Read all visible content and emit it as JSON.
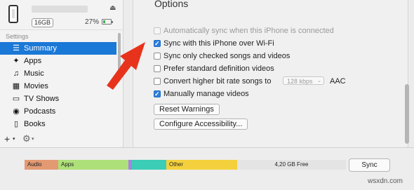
{
  "device": {
    "capacity": "16GB",
    "battery": "27%",
    "eject_icon": "eject-icon"
  },
  "sidebar": {
    "section_header": "Settings",
    "items": [
      {
        "label": "Summary",
        "icon": "summary-icon",
        "selected": true
      },
      {
        "label": "Apps",
        "icon": "apps-icon"
      },
      {
        "label": "Music",
        "icon": "music-icon"
      },
      {
        "label": "Movies",
        "icon": "movies-icon"
      },
      {
        "label": "TV Shows",
        "icon": "tv-icon"
      },
      {
        "label": "Podcasts",
        "icon": "podcasts-icon"
      },
      {
        "label": "Books",
        "icon": "books-icon"
      }
    ]
  },
  "options": {
    "title": "Options",
    "auto_sync": {
      "label": "Automatically sync when this iPhone is connected",
      "checked": false,
      "enabled": false
    },
    "sync_wifi": {
      "label": "Sync with this iPhone over Wi-Fi",
      "checked": true
    },
    "sync_checked": {
      "label": "Sync only checked songs and videos",
      "checked": false
    },
    "prefer_sd": {
      "label": "Prefer standard definition videos",
      "checked": false
    },
    "convert_bitrate": {
      "label": "Convert higher bit rate songs to",
      "checked": false,
      "bitrate": "128 kbps",
      "format": "AAC"
    },
    "manual_manage": {
      "label": "Manually manage videos",
      "checked": true
    },
    "reset_warnings": "Reset Warnings",
    "configure_accessibility": "Configure Accessibility..."
  },
  "capacity_bar": {
    "audio_label": "Audio",
    "apps_label": "Apps",
    "other_label": "Other",
    "free_label": "4,20 GB Free",
    "audio_color": "#e39a73",
    "apps_color": "#aee07a",
    "purple_color": "#a682e6",
    "teal_color": "#3ccdb7",
    "other_color": "#f4d13c",
    "free_color": "#e4e4e4"
  },
  "sync_button": "Sync",
  "watermark": "wsxdn.com",
  "annotation_arrow_color": "#e8331c"
}
